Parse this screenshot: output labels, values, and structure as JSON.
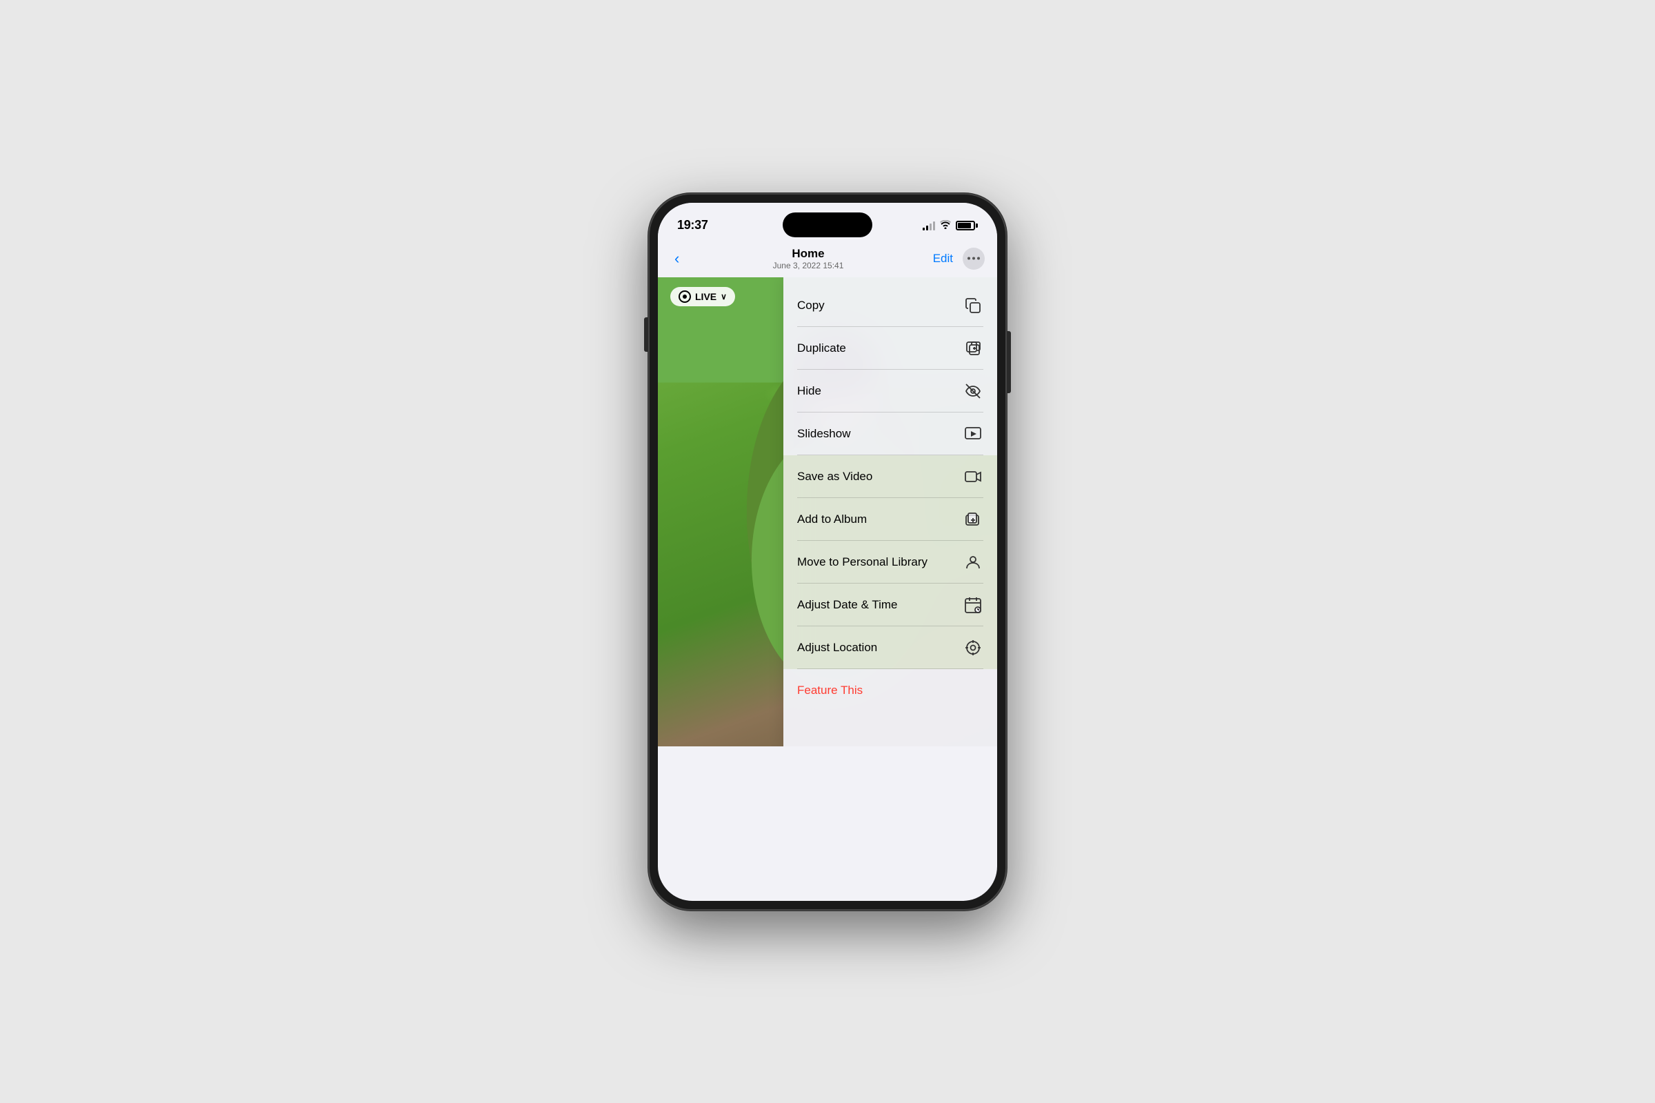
{
  "status": {
    "time": "19:37",
    "signal_label": "signal",
    "wifi_label": "wifi",
    "battery_label": "battery"
  },
  "nav": {
    "back_label": "‹",
    "title": "Home",
    "subtitle": "June 3, 2022  15:41",
    "edit_label": "Edit",
    "more_label": "···"
  },
  "photo": {
    "live_label": "LIVE",
    "live_chevron": "∨"
  },
  "menu": {
    "items": [
      {
        "id": "copy",
        "label": "Copy",
        "icon": "copy-icon"
      },
      {
        "id": "duplicate",
        "label": "Duplicate",
        "icon": "duplicate-icon"
      },
      {
        "id": "hide",
        "label": "Hide",
        "icon": "hide-icon"
      },
      {
        "id": "slideshow",
        "label": "Slideshow",
        "icon": "slideshow-icon"
      },
      {
        "id": "save-as-video",
        "label": "Save as Video",
        "icon": "video-icon"
      },
      {
        "id": "add-to-album",
        "label": "Add to Album",
        "icon": "add-album-icon"
      },
      {
        "id": "move-to-personal",
        "label": "Move to Personal Library",
        "icon": "person-icon"
      },
      {
        "id": "adjust-date",
        "label": "Adjust Date & Time",
        "icon": "calendar-icon"
      },
      {
        "id": "adjust-location",
        "label": "Adjust Location",
        "icon": "location-icon"
      },
      {
        "id": "feature-this",
        "label": "Feature This",
        "icon": "feature-icon",
        "type": "feature"
      }
    ]
  }
}
